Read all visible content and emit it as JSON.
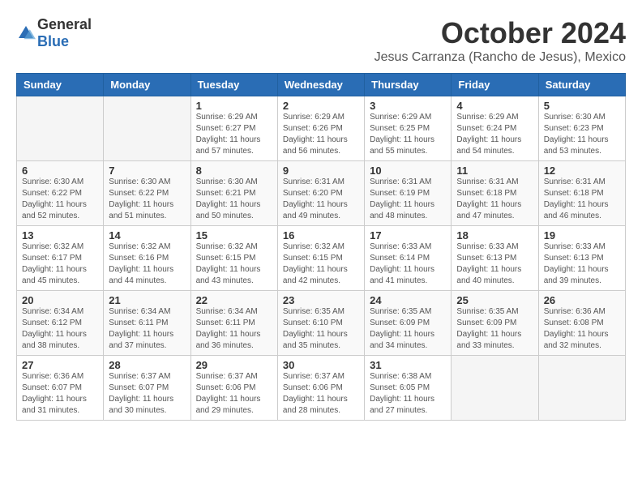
{
  "header": {
    "logo_general": "General",
    "logo_blue": "Blue",
    "month": "October 2024",
    "location": "Jesus Carranza (Rancho de Jesus), Mexico"
  },
  "weekdays": [
    "Sunday",
    "Monday",
    "Tuesday",
    "Wednesday",
    "Thursday",
    "Friday",
    "Saturday"
  ],
  "weeks": [
    [
      {
        "day": "",
        "info": ""
      },
      {
        "day": "",
        "info": ""
      },
      {
        "day": "1",
        "info": "Sunrise: 6:29 AM\nSunset: 6:27 PM\nDaylight: 11 hours and 57 minutes."
      },
      {
        "day": "2",
        "info": "Sunrise: 6:29 AM\nSunset: 6:26 PM\nDaylight: 11 hours and 56 minutes."
      },
      {
        "day": "3",
        "info": "Sunrise: 6:29 AM\nSunset: 6:25 PM\nDaylight: 11 hours and 55 minutes."
      },
      {
        "day": "4",
        "info": "Sunrise: 6:29 AM\nSunset: 6:24 PM\nDaylight: 11 hours and 54 minutes."
      },
      {
        "day": "5",
        "info": "Sunrise: 6:30 AM\nSunset: 6:23 PM\nDaylight: 11 hours and 53 minutes."
      }
    ],
    [
      {
        "day": "6",
        "info": "Sunrise: 6:30 AM\nSunset: 6:22 PM\nDaylight: 11 hours and 52 minutes."
      },
      {
        "day": "7",
        "info": "Sunrise: 6:30 AM\nSunset: 6:22 PM\nDaylight: 11 hours and 51 minutes."
      },
      {
        "day": "8",
        "info": "Sunrise: 6:30 AM\nSunset: 6:21 PM\nDaylight: 11 hours and 50 minutes."
      },
      {
        "day": "9",
        "info": "Sunrise: 6:31 AM\nSunset: 6:20 PM\nDaylight: 11 hours and 49 minutes."
      },
      {
        "day": "10",
        "info": "Sunrise: 6:31 AM\nSunset: 6:19 PM\nDaylight: 11 hours and 48 minutes."
      },
      {
        "day": "11",
        "info": "Sunrise: 6:31 AM\nSunset: 6:18 PM\nDaylight: 11 hours and 47 minutes."
      },
      {
        "day": "12",
        "info": "Sunrise: 6:31 AM\nSunset: 6:18 PM\nDaylight: 11 hours and 46 minutes."
      }
    ],
    [
      {
        "day": "13",
        "info": "Sunrise: 6:32 AM\nSunset: 6:17 PM\nDaylight: 11 hours and 45 minutes."
      },
      {
        "day": "14",
        "info": "Sunrise: 6:32 AM\nSunset: 6:16 PM\nDaylight: 11 hours and 44 minutes."
      },
      {
        "day": "15",
        "info": "Sunrise: 6:32 AM\nSunset: 6:15 PM\nDaylight: 11 hours and 43 minutes."
      },
      {
        "day": "16",
        "info": "Sunrise: 6:32 AM\nSunset: 6:15 PM\nDaylight: 11 hours and 42 minutes."
      },
      {
        "day": "17",
        "info": "Sunrise: 6:33 AM\nSunset: 6:14 PM\nDaylight: 11 hours and 41 minutes."
      },
      {
        "day": "18",
        "info": "Sunrise: 6:33 AM\nSunset: 6:13 PM\nDaylight: 11 hours and 40 minutes."
      },
      {
        "day": "19",
        "info": "Sunrise: 6:33 AM\nSunset: 6:13 PM\nDaylight: 11 hours and 39 minutes."
      }
    ],
    [
      {
        "day": "20",
        "info": "Sunrise: 6:34 AM\nSunset: 6:12 PM\nDaylight: 11 hours and 38 minutes."
      },
      {
        "day": "21",
        "info": "Sunrise: 6:34 AM\nSunset: 6:11 PM\nDaylight: 11 hours and 37 minutes."
      },
      {
        "day": "22",
        "info": "Sunrise: 6:34 AM\nSunset: 6:11 PM\nDaylight: 11 hours and 36 minutes."
      },
      {
        "day": "23",
        "info": "Sunrise: 6:35 AM\nSunset: 6:10 PM\nDaylight: 11 hours and 35 minutes."
      },
      {
        "day": "24",
        "info": "Sunrise: 6:35 AM\nSunset: 6:09 PM\nDaylight: 11 hours and 34 minutes."
      },
      {
        "day": "25",
        "info": "Sunrise: 6:35 AM\nSunset: 6:09 PM\nDaylight: 11 hours and 33 minutes."
      },
      {
        "day": "26",
        "info": "Sunrise: 6:36 AM\nSunset: 6:08 PM\nDaylight: 11 hours and 32 minutes."
      }
    ],
    [
      {
        "day": "27",
        "info": "Sunrise: 6:36 AM\nSunset: 6:07 PM\nDaylight: 11 hours and 31 minutes."
      },
      {
        "day": "28",
        "info": "Sunrise: 6:37 AM\nSunset: 6:07 PM\nDaylight: 11 hours and 30 minutes."
      },
      {
        "day": "29",
        "info": "Sunrise: 6:37 AM\nSunset: 6:06 PM\nDaylight: 11 hours and 29 minutes."
      },
      {
        "day": "30",
        "info": "Sunrise: 6:37 AM\nSunset: 6:06 PM\nDaylight: 11 hours and 28 minutes."
      },
      {
        "day": "31",
        "info": "Sunrise: 6:38 AM\nSunset: 6:05 PM\nDaylight: 11 hours and 27 minutes."
      },
      {
        "day": "",
        "info": ""
      },
      {
        "day": "",
        "info": ""
      }
    ]
  ]
}
